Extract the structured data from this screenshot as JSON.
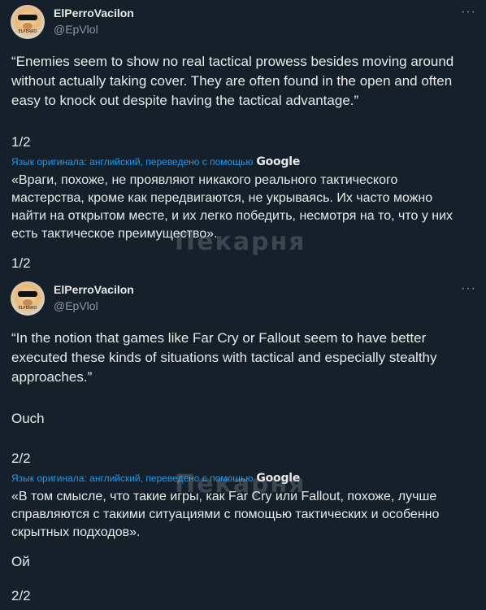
{
  "tweets": [
    {
      "display_name": "ElPerroVacilon",
      "handle": "@EpVlol",
      "more": "···",
      "avatar_caption": "ELPERRO",
      "original_text": "“Enemies seem to show no real tactical prowess besides moving around without actually taking cover. They are often found in the open and often easy to knock out despite having the tactical advantage.”",
      "page_original": "1/2",
      "translation_note": "Язык оригинала: английский, переведено с помощью",
      "translation_brand": "Google",
      "translated_text": "«Враги, похоже, не проявляют никакого реального тактического мастерства, кроме как передвигаются, не укрываясь. Их часто можно найти на открытом месте, и их легко победить, несмотря на то, что у них есть тактическое преимущество».",
      "page_translated": "1/2"
    },
    {
      "display_name": "ElPerroVacilon",
      "handle": "@EpVlol",
      "more": "···",
      "avatar_caption": "ELPERRO",
      "original_text": "“In the notion that games like Far Cry or Fallout seem to have better executed these kinds of situations with tactical and especially stealthy approaches.”",
      "extra_original": "Ouch",
      "page_original": "2/2",
      "translation_note": "Язык оригинала: английский, переведено с помощью",
      "translation_brand": "Google",
      "translated_text": "«В том смысле, что такие игры, как Far Cry или Fallout, похоже, лучше справляются с такими ситуациями с помощью тактических и особенно скрытных подходов».",
      "extra_translated": "Ой",
      "page_translated": "2/2"
    }
  ],
  "watermark": "Пекарня"
}
